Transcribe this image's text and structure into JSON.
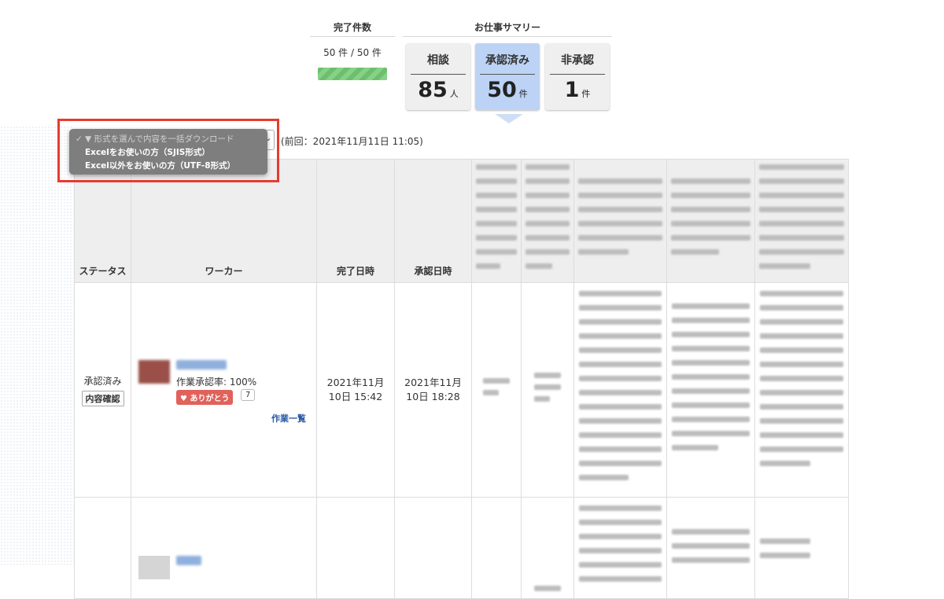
{
  "summary": {
    "done_header": "完了件数",
    "done_count": "50 件 / 50 件",
    "done_progress": 1.0,
    "work_header": "お仕事サマリー",
    "cards": [
      {
        "label": "相談",
        "value": "85",
        "unit": "人",
        "active": false
      },
      {
        "label": "承認済み",
        "value": "50",
        "unit": "件",
        "active": true
      },
      {
        "label": "非承認",
        "value": "1",
        "unit": "件",
        "active": false
      }
    ]
  },
  "download": {
    "placeholder": "▼ 形式を選んで内容を一括ダウンロード",
    "check_mark": "✓",
    "options": [
      "Excelをお使いの方（SJIS形式）",
      "Excel以外をお使いの方（UTF-8形式）"
    ],
    "prev_time": "(前回：2021年11月11日 11:05)",
    "highlight_color": "#e63b2e"
  },
  "table": {
    "headers": {
      "status": "ステータス",
      "worker": "ワーカー",
      "completed": "完了日時",
      "approved": "承認日時"
    },
    "rows": [
      {
        "status": "承認済み",
        "detail_button": "内容確認",
        "approval_rate": "作業承認率: 100%",
        "thanks_label": "♥ ありがとう",
        "thanks_count": "7",
        "work_list": "作業一覧",
        "completed": "2021年11月10日 15:42",
        "completed_line1": "2021年11月",
        "completed_line2": "10日 15:42",
        "approved_line1": "2021年11月",
        "approved_line2": "10日 18:28"
      }
    ]
  },
  "colors": {
    "active_card": "#bcd3f5",
    "thanks": "#e0625b",
    "progress": "#6cbf6c",
    "link": "#2b5aa6"
  }
}
